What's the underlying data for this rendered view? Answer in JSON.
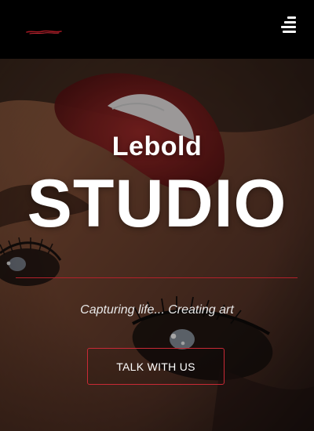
{
  "header": {
    "menu_icon": "hamburger-menu-icon",
    "logo_icon": "studio-logo"
  },
  "hero": {
    "brand": "Lebold",
    "title": "STUDIO",
    "tagline": "Capturing life... Creating art",
    "cta_label": "TALK WITH US"
  },
  "colors": {
    "accent": "#c92a36",
    "header_bg": "#000000",
    "text": "#ffffff"
  }
}
